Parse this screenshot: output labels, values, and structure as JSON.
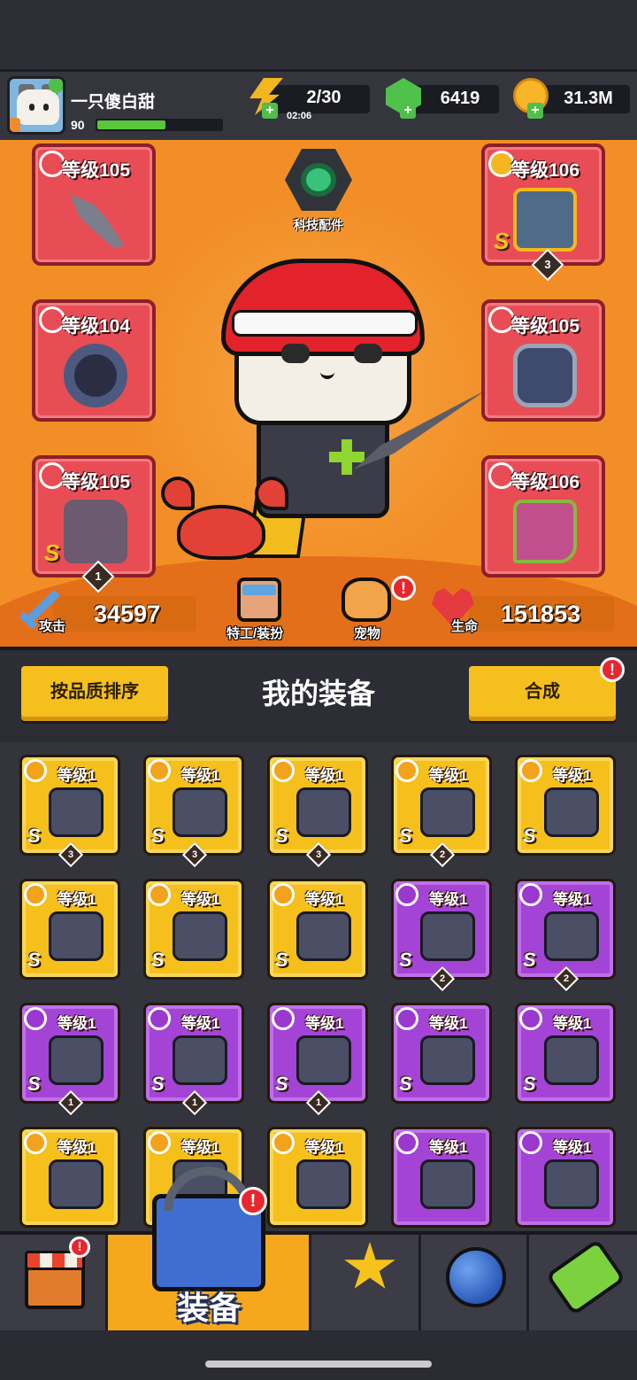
{
  "player": {
    "name": "一只傻白甜",
    "level": "90",
    "xp_fraction": 0.55
  },
  "resources": {
    "energy": "2/30",
    "energy_timer": "02:06",
    "gems": "6419",
    "coins": "31.3M"
  },
  "stage": {
    "tech_label": "科技配件",
    "slots": [
      {
        "label": "等级105",
        "icon": "kunai-icon",
        "grade": "",
        "stars": ""
      },
      {
        "label": "等级104",
        "icon": "necklace-icon",
        "grade": "",
        "stars": ""
      },
      {
        "label": "等级105",
        "icon": "glove-icon",
        "grade": "S",
        "stars": "1"
      },
      {
        "label": "等级106",
        "icon": "armor-icon",
        "grade": "S",
        "stars": "3"
      },
      {
        "label": "等级105",
        "icon": "belt-icon",
        "grade": "",
        "stars": ""
      },
      {
        "label": "等级106",
        "icon": "boot-icon",
        "grade": "",
        "stars": ""
      }
    ],
    "attack_label": "攻击",
    "attack_value": "34597",
    "agent_label": "特工/装扮",
    "pet_label": "宠物",
    "pet_badge": "!",
    "hp_label": "生命",
    "hp_value": "151853"
  },
  "toolbar": {
    "sort_label": "按品质排序",
    "title": "我的装备",
    "merge_label": "合成",
    "merge_badge": "!"
  },
  "inventory": [
    {
      "level": "等级1",
      "grade": "S",
      "stars": "3",
      "rarity": "gold",
      "icon": "gauntlet-icon"
    },
    {
      "level": "等级1",
      "grade": "S",
      "stars": "3",
      "rarity": "gold",
      "icon": "belt-icon"
    },
    {
      "level": "等级1",
      "grade": "S",
      "stars": "3",
      "rarity": "gold",
      "icon": "boot-icon"
    },
    {
      "level": "等级1",
      "grade": "S",
      "stars": "2",
      "rarity": "gold",
      "icon": "necklace-icon"
    },
    {
      "level": "等级1",
      "grade": "S",
      "stars": "",
      "rarity": "gold",
      "icon": "sword-icon"
    },
    {
      "level": "等级1",
      "grade": "S",
      "stars": "",
      "rarity": "gold",
      "icon": "gauntlet-icon"
    },
    {
      "level": "等级1",
      "grade": "S",
      "stars": "",
      "rarity": "gold",
      "icon": "necklace-icon"
    },
    {
      "level": "等级1",
      "grade": "S",
      "stars": "",
      "rarity": "gold",
      "icon": "belt-icon"
    },
    {
      "level": "等级1",
      "grade": "S",
      "stars": "2",
      "rarity": "purple",
      "icon": "armor-icon"
    },
    {
      "level": "等级1",
      "grade": "S",
      "stars": "2",
      "rarity": "purple",
      "icon": "boot-icon"
    },
    {
      "level": "等级1",
      "grade": "S",
      "stars": "1",
      "rarity": "purple",
      "icon": "sword-icon"
    },
    {
      "level": "等级1",
      "grade": "S",
      "stars": "1",
      "rarity": "purple",
      "icon": "kunai-icon"
    },
    {
      "level": "等级1",
      "grade": "S",
      "stars": "1",
      "rarity": "purple",
      "icon": "boot-icon"
    },
    {
      "level": "等级1",
      "grade": "S",
      "stars": "",
      "rarity": "purple",
      "icon": "gauntlet-icon"
    },
    {
      "level": "等级1",
      "grade": "S",
      "stars": "",
      "rarity": "purple",
      "icon": "belt-icon"
    },
    {
      "level": "等级1",
      "grade": "",
      "stars": "",
      "rarity": "gold",
      "icon": "armor-icon"
    },
    {
      "level": "等级1",
      "grade": "",
      "stars": "",
      "rarity": "gold",
      "icon": "armor-icon"
    },
    {
      "level": "等级1",
      "grade": "",
      "stars": "",
      "rarity": "gold",
      "icon": "armor-icon"
    },
    {
      "level": "等级1",
      "grade": "",
      "stars": "",
      "rarity": "purple",
      "icon": "armor-icon"
    },
    {
      "level": "等级1",
      "grade": "",
      "stars": "",
      "rarity": "purple",
      "icon": "boot-icon"
    }
  ],
  "nav": {
    "shop_badge": "!",
    "equip_label": "装备",
    "equip_badge": "!"
  },
  "colors": {
    "stage_orange": "#f28e26",
    "slot_red": "#e84d55",
    "rarity_gold": "#f5bf1c",
    "rarity_purple": "#a344d6",
    "accent_yellow": "#f5c01e"
  }
}
